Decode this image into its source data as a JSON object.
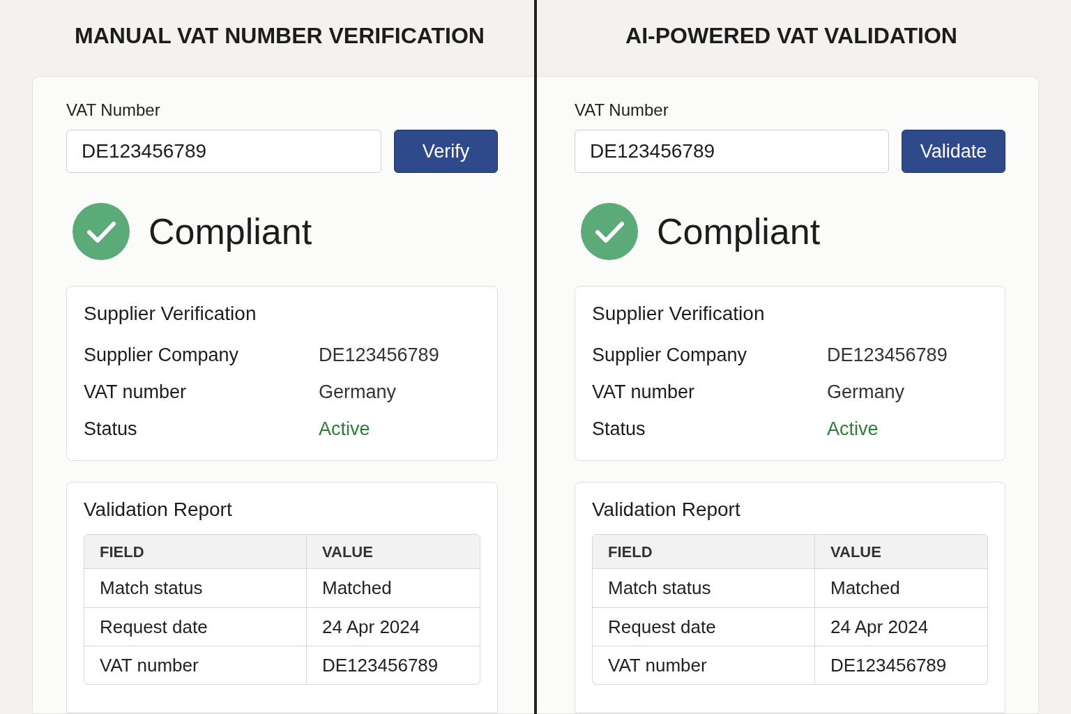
{
  "panels": [
    {
      "title": "MANUAL VAT NUMBER VERIFICATION",
      "field_label": "VAT Number",
      "field_value": "DE123456789",
      "button": "Verify",
      "status": "Compliant",
      "supplier": {
        "title": "Supplier Verification",
        "rows": [
          {
            "label": "Supplier Company",
            "value": "DE123456789",
            "kind": "text"
          },
          {
            "label": "VAT number",
            "value": "Germany",
            "kind": "text"
          },
          {
            "label": "Status",
            "value": "Active",
            "kind": "status"
          }
        ]
      },
      "report": {
        "title": "Validation Report",
        "columns": [
          "FIELD",
          "VALUE"
        ],
        "rows": [
          [
            "Match status",
            "Matched"
          ],
          [
            "Request date",
            "24 Apr 2024"
          ],
          [
            "VAT number",
            "DE123456789"
          ]
        ]
      }
    },
    {
      "title": "AI-POWERED VAT VALIDATION",
      "field_label": "VAT Number",
      "field_value": "DE123456789",
      "button": "Validate",
      "status": "Compliant",
      "supplier": {
        "title": "Supplier Verification",
        "rows": [
          {
            "label": "Supplier Company",
            "value": "DE123456789",
            "kind": "text"
          },
          {
            "label": "VAT number",
            "value": "Germany",
            "kind": "text"
          },
          {
            "label": "Status",
            "value": "Active",
            "kind": "status"
          }
        ]
      },
      "report": {
        "title": "Validation Report",
        "columns": [
          "FIELD",
          "VALUE"
        ],
        "rows": [
          [
            "Match status",
            "Matched"
          ],
          [
            "Request date",
            "24 Apr 2024"
          ],
          [
            "VAT number",
            "DE123456789"
          ]
        ]
      }
    }
  ]
}
